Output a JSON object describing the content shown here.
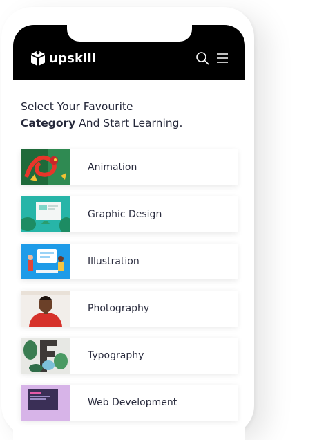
{
  "app": {
    "brand": "upskill"
  },
  "header": {
    "search_icon": "search-icon",
    "menu_icon": "hamburger-menu-icon"
  },
  "intro": {
    "line1": "Select Your Favourite",
    "emphasis": "Category",
    "line2_rest": " And Start Learning."
  },
  "categories": [
    {
      "label": "Animation",
      "thumb": "animation-thumbnail"
    },
    {
      "label": "Graphic Design",
      "thumb": "graphic-design-thumbnail"
    },
    {
      "label": "Illustration",
      "thumb": "illustration-thumbnail"
    },
    {
      "label": "Photography",
      "thumb": "photography-thumbnail"
    },
    {
      "label": "Typography",
      "thumb": "typography-thumbnail"
    },
    {
      "label": "Web Development",
      "thumb": "web-development-thumbnail"
    }
  ]
}
